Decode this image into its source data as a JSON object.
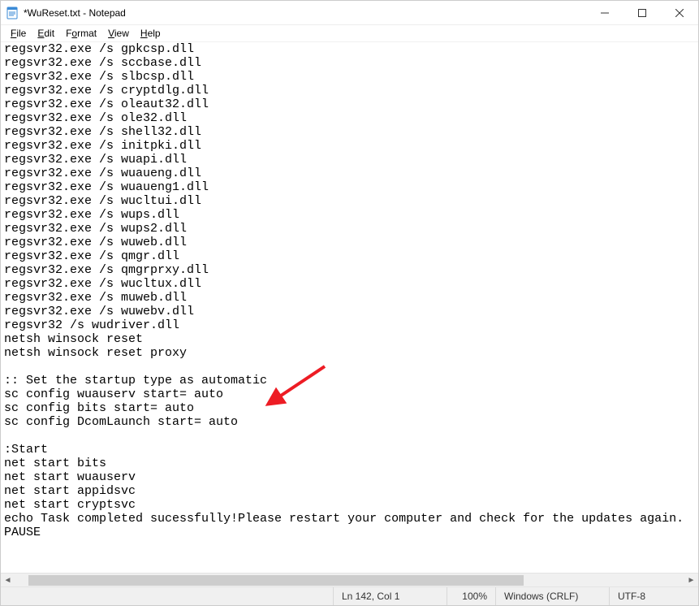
{
  "window": {
    "title": "*WuReset.txt - Notepad"
  },
  "menu": {
    "file": "File",
    "edit": "Edit",
    "format": "Format",
    "view": "View",
    "help": "Help"
  },
  "content": "regsvr32.exe /s gpkcsp.dll\nregsvr32.exe /s sccbase.dll\nregsvr32.exe /s slbcsp.dll\nregsvr32.exe /s cryptdlg.dll\nregsvr32.exe /s oleaut32.dll\nregsvr32.exe /s ole32.dll\nregsvr32.exe /s shell32.dll\nregsvr32.exe /s initpki.dll\nregsvr32.exe /s wuapi.dll\nregsvr32.exe /s wuaueng.dll\nregsvr32.exe /s wuaueng1.dll\nregsvr32.exe /s wucltui.dll\nregsvr32.exe /s wups.dll\nregsvr32.exe /s wups2.dll\nregsvr32.exe /s wuweb.dll\nregsvr32.exe /s qmgr.dll\nregsvr32.exe /s qmgrprxy.dll\nregsvr32.exe /s wucltux.dll\nregsvr32.exe /s muweb.dll\nregsvr32.exe /s wuwebv.dll\nregsvr32 /s wudriver.dll\nnetsh winsock reset\nnetsh winsock reset proxy\n\n:: Set the startup type as automatic\nsc config wuauserv start= auto\nsc config bits start= auto\nsc config DcomLaunch start= auto\n\n:Start\nnet start bits\nnet start wuauserv\nnet start appidsvc\nnet start cryptsvc\necho Task completed sucessfully!Please restart your computer and check for the updates again.\nPAUSE",
  "status": {
    "position": "Ln 142, Col 1",
    "zoom": "100%",
    "ending": "Windows (CRLF)",
    "encoding": "UTF-8"
  }
}
